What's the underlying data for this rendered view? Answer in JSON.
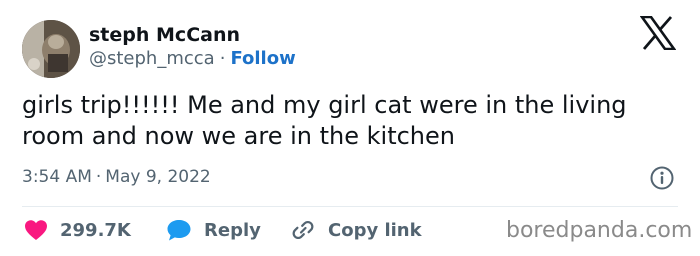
{
  "author": {
    "display_name": "steph McCann",
    "handle": "@steph_mcca",
    "separator": "·",
    "follow_label": "Follow"
  },
  "tweet": {
    "text": "girls trip!!!!!! Me and my girl cat were in the living room and now we are in the kitchen",
    "time": "3:54 AM",
    "separator": "·",
    "date": "May 9, 2022"
  },
  "actions": {
    "like_count": "299.7K",
    "reply_label": "Reply",
    "copy_link_label": "Copy link"
  },
  "watermark": "boredpanda.com",
  "icons": {
    "platform": "x-logo-icon",
    "info": "info-icon",
    "like": "heart-icon",
    "reply": "speech-bubble-icon",
    "copy": "link-icon"
  },
  "colors": {
    "heart": "#f91880",
    "reply_bubble": "#1d9bf0",
    "follow": "#1d72c9",
    "secondary_text": "#536471",
    "primary_text": "#0f1419"
  }
}
